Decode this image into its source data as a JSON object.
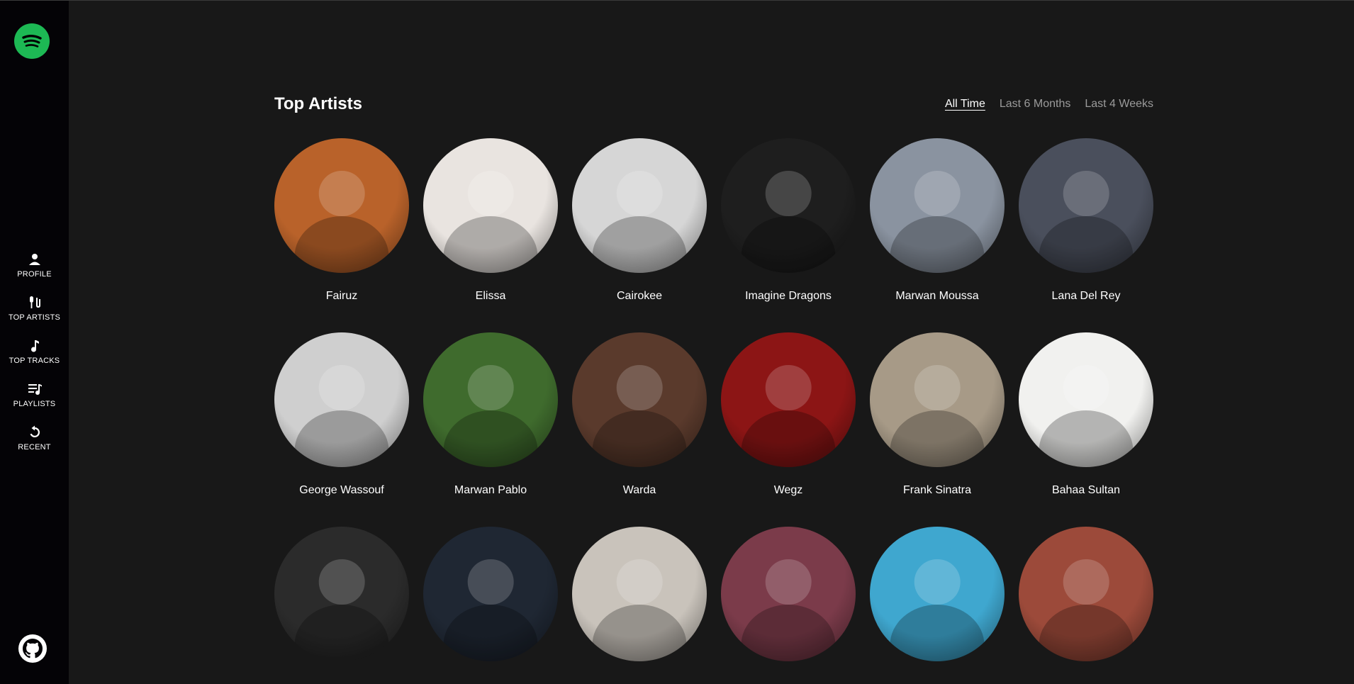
{
  "sidebar": {
    "nav": [
      {
        "label": "PROFILE",
        "icon": "user-icon"
      },
      {
        "label": "TOP ARTISTS",
        "icon": "microphone-icon"
      },
      {
        "label": "TOP TRACKS",
        "icon": "music-note-icon"
      },
      {
        "label": "PLAYLISTS",
        "icon": "playlist-icon"
      },
      {
        "label": "RECENT",
        "icon": "history-icon"
      }
    ]
  },
  "header": {
    "title": "Top Artists",
    "ranges": [
      "All Time",
      "Last 6 Months",
      "Last 4 Weeks"
    ],
    "active_range": "All Time"
  },
  "artists": [
    {
      "name": "Fairuz",
      "color": "#b9622a"
    },
    {
      "name": "Elissa",
      "color": "#e9e4e0"
    },
    {
      "name": "Cairokee",
      "color": "#d6d6d6"
    },
    {
      "name": "Imagine Dragons",
      "color": "#1e1e1e"
    },
    {
      "name": "Marwan Moussa",
      "color": "#8a93a0"
    },
    {
      "name": "Lana Del Rey",
      "color": "#4a4f5c"
    },
    {
      "name": "George Wassouf",
      "color": "#cfcfcf"
    },
    {
      "name": "Marwan Pablo",
      "color": "#3f6b2d"
    },
    {
      "name": "Warda",
      "color": "#5a3a2c"
    },
    {
      "name": "Wegz",
      "color": "#8c1515"
    },
    {
      "name": "Frank Sinatra",
      "color": "#a79a87"
    },
    {
      "name": "Bahaa Sultan",
      "color": "#f1f1ef"
    },
    {
      "name": "",
      "color": "#2b2b2b"
    },
    {
      "name": "",
      "color": "#1f2733"
    },
    {
      "name": "",
      "color": "#c9c3bb"
    },
    {
      "name": "",
      "color": "#7b3b4a"
    },
    {
      "name": "",
      "color": "#3fa7cf"
    },
    {
      "name": "",
      "color": "#9c4a3a"
    }
  ],
  "colors": {
    "background": "#181818",
    "sidebar": "#040306",
    "accent": "#1db954"
  }
}
